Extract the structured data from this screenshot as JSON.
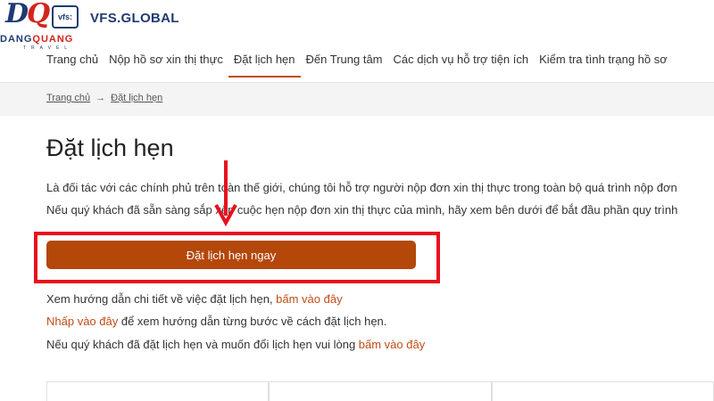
{
  "logo": {
    "d": "D",
    "q": "Q",
    "dq_name_1": "DANG",
    "dq_name_2": "QUANG",
    "dq_travel": "TRAVEL",
    "vfs_mark": "vfs:"
  },
  "header": {
    "site_name": "VFS.GLOBAL"
  },
  "nav": {
    "items": [
      {
        "label": "Trang chủ"
      },
      {
        "label": "Nộp hồ sơ xin thị thực"
      },
      {
        "label": "Đặt lịch hẹn"
      },
      {
        "label": "Đến Trung tâm"
      },
      {
        "label": "Các dịch vụ hỗ trợ tiện ích"
      },
      {
        "label": "Kiểm tra tình trạng hồ sơ"
      }
    ],
    "active": "Đặt lịch hẹn"
  },
  "breadcrumb": {
    "home": "Trang chủ",
    "separator": "→",
    "current": "Đặt lịch hẹn"
  },
  "main": {
    "title": "Đặt lịch hẹn",
    "intro_line_1": "Là đối tác với các chính phủ trên toàn thế giới, chúng tôi hỗ trợ người nộp đơn xin thị thực trong toàn bộ quá trình nộp đơn",
    "intro_line_2": "Nếu quý khách đã sẵn sàng sắp xếp cuộc hẹn nộp đơn xin thị thực của mình, hãy xem bên dưới để bắt đầu phần quy trình",
    "book_button": "Đặt lịch hẹn ngay",
    "guide_text": "Xem hướng dẫn chi tiết về việc đặt lịch hẹn, ",
    "guide_link": "bấm vào đây",
    "step_link": "Nhấp vào đây",
    "step_text": " để xem hướng dẫn từng bước về cách đặt lịch hẹn.",
    "reschedule_text": "Nếu quý khách đã đặt lịch hẹn và muốn đổi lịch hẹn vui lòng ",
    "reschedule_link": "bấm vào đây"
  },
  "colors": {
    "accent": "#b4470a",
    "link": "#c14d16",
    "highlight": "#e8101c",
    "brand": "#1f3a73"
  }
}
